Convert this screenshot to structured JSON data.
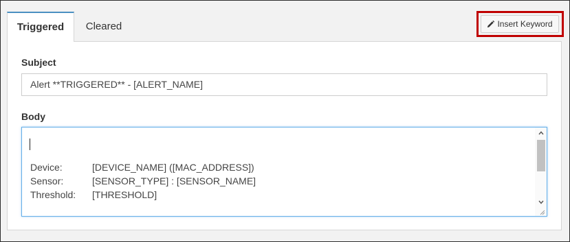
{
  "tabs": [
    {
      "label": "Triggered",
      "active": true
    },
    {
      "label": "Cleared",
      "active": false
    }
  ],
  "toolbar": {
    "insert_keyword_label": "Insert Keyword",
    "insert_keyword_icon": "pencil-icon",
    "highlight_color": "#c00000"
  },
  "form": {
    "subject_label": "Subject",
    "subject_value": "Alert **TRIGGERED** - [ALERT_NAME]",
    "body_label": "Body",
    "body_lines": [
      {
        "key": "Device:",
        "value": "[DEVICE_NAME] ([MAC_ADDRESS])"
      },
      {
        "key": "Sensor:",
        "value": "[SENSOR_TYPE] : [SENSOR_NAME]"
      },
      {
        "key": "Threshold:",
        "value": "[THRESHOLD]"
      }
    ]
  },
  "colors": {
    "active_tab_accent": "#4a8fc2",
    "focus_border": "#66afe9"
  }
}
